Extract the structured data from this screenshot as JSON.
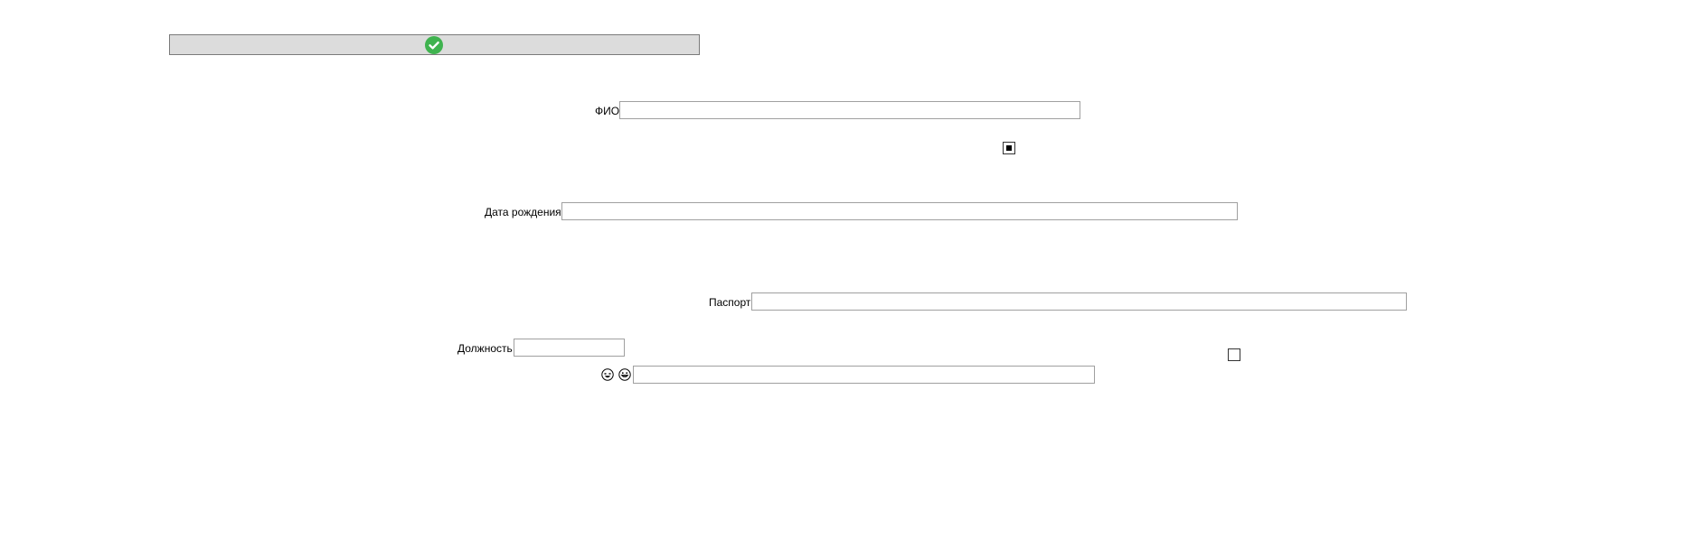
{
  "toolbar": {
    "status_icon": "check-circle-icon",
    "status_color": "#3fb34f"
  },
  "form": {
    "fio": {
      "label": "ФИО",
      "value": ""
    },
    "confirm_checkbox": {
      "checked": true
    },
    "birth_date": {
      "label": "Дата рождения",
      "value": ""
    },
    "passport": {
      "label": "Паспорт",
      "value": ""
    },
    "position": {
      "label": "Должность",
      "value": ""
    },
    "right_checkbox": {
      "checked": false
    },
    "emoji_field": {
      "icons": [
        "laughing-emoji-icon",
        "grinning-emoji-icon"
      ],
      "value": ""
    }
  }
}
